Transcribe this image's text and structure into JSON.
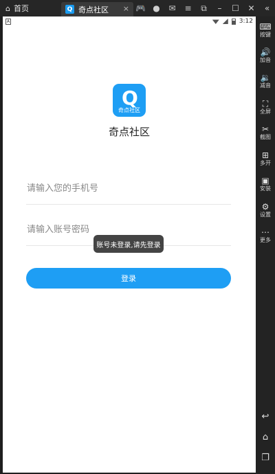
{
  "window": {
    "home_tab_label": "首页",
    "active_tab_label": "奇点社区",
    "active_tab_icon_letter": "Q",
    "close_glyph": "×"
  },
  "top_icons": [
    "gamepad-icon",
    "user-icon",
    "mail-icon",
    "menu-icon",
    "popout-icon",
    "minimize-icon",
    "maximize-icon",
    "close-icon",
    "collapse-icon"
  ],
  "statusbar": {
    "time": "3:12",
    "left_badge": "A"
  },
  "app": {
    "logo_letter": "Q",
    "logo_text": "奇点社区",
    "name": "奇点社区"
  },
  "login": {
    "phone_placeholder": "请输入您的手机号",
    "password_placeholder": "请输入账号密码",
    "button_label": "登录"
  },
  "toast": {
    "message": "账号未登录,请先登录"
  },
  "sidebar": {
    "items": [
      {
        "label": "按键",
        "icon": "keyboard-icon",
        "glyph": "⌨"
      },
      {
        "label": "加音",
        "icon": "volume-up-icon",
        "glyph": "🔊"
      },
      {
        "label": "减音",
        "icon": "volume-down-icon",
        "glyph": "🔉"
      },
      {
        "label": "全屏",
        "icon": "fullscreen-icon",
        "glyph": "⛶"
      },
      {
        "label": "截图",
        "icon": "scissors-icon",
        "glyph": "✂"
      },
      {
        "label": "多开",
        "icon": "multi-instance-icon",
        "glyph": "⊞"
      },
      {
        "label": "安装",
        "icon": "apk-install-icon",
        "glyph": "▣"
      },
      {
        "label": "设置",
        "icon": "gear-icon",
        "glyph": "⚙"
      },
      {
        "label": "更多",
        "icon": "more-icon",
        "glyph": "⋯"
      }
    ],
    "nav": [
      {
        "icon": "back-icon",
        "glyph": "↩"
      },
      {
        "icon": "home-icon",
        "glyph": "⌂"
      },
      {
        "icon": "recent-apps-icon",
        "glyph": "❐"
      }
    ]
  },
  "colors": {
    "accent": "#1e9ef4",
    "toast_bg": "#444444",
    "chrome_bg": "#232323"
  }
}
